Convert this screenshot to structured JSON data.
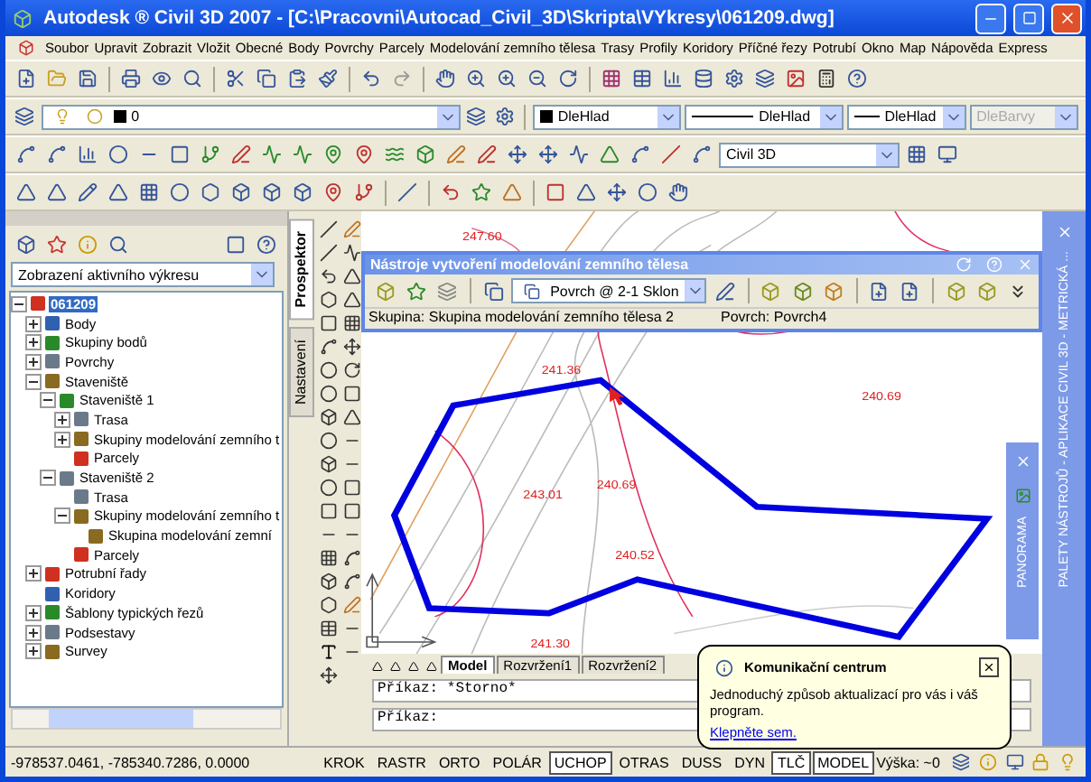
{
  "window": {
    "title": "Autodesk ® Civil 3D 2007 - [C:\\Pracovni\\Autocad_Civil_3D\\Skripta\\VYkresy\\061209.dwg]"
  },
  "menu": [
    "Soubor",
    "Upravit",
    "Zobrazit",
    "Vložit",
    "Obecné",
    "Body",
    "Povrchy",
    "Parcely",
    "Modelování zemního tělesa",
    "Trasy",
    "Profily",
    "Koridory",
    "Příčné řezy",
    "Potrubí",
    "Okno",
    "Map",
    "Nápověda",
    "Express"
  ],
  "layer_toolbar": {
    "layer": "0",
    "color_setting": "DleHlad",
    "linetype": "DleHlad",
    "lineweight": "DleHlad",
    "plot_style": {
      "value": "DleBarvy",
      "disabled": true
    }
  },
  "workspace": "Civil 3D",
  "prospector": {
    "view": "Zobrazení aktivního výkresu",
    "tree": [
      {
        "label": "061209",
        "selected": true,
        "expanded": true,
        "children": [
          {
            "label": "Body",
            "selected": false,
            "expanded": false
          },
          {
            "label": "Skupiny bodů",
            "selected": false,
            "expanded": false
          },
          {
            "label": "Povrchy",
            "selected": false,
            "expanded": false
          },
          {
            "label": "Staveniště",
            "selected": false,
            "expanded": true,
            "children": [
              {
                "label": "Staveniště 1",
                "selected": false,
                "expanded": true,
                "children": [
                  {
                    "label": "Trasa",
                    "selected": false,
                    "expanded": false
                  },
                  {
                    "label": "Skupiny modelování zemního t",
                    "selected": false,
                    "expanded": false
                  },
                  {
                    "label": "Parcely",
                    "selected": false
                  }
                ]
              },
              {
                "label": "Staveniště 2",
                "selected": false,
                "expanded": true,
                "children": [
                  {
                    "label": "Trasa",
                    "selected": false
                  },
                  {
                    "label": "Skupiny modelování zemního t",
                    "selected": false,
                    "expanded": true,
                    "children": [
                      {
                        "label": "Skupina modelování zemní",
                        "selected": false
                      }
                    ]
                  },
                  {
                    "label": "Parcely",
                    "selected": false
                  }
                ]
              }
            ]
          },
          {
            "label": "Potrubní řady",
            "selected": false,
            "expanded": false
          },
          {
            "label": "Koridory",
            "selected": false
          },
          {
            "label": "Šablony typických řezů",
            "selected": false,
            "expanded": false
          },
          {
            "label": "Podsestavy",
            "selected": false,
            "expanded": false
          },
          {
            "label": "Survey",
            "selected": false,
            "expanded": false
          }
        ]
      }
    ]
  },
  "side_tabs": [
    {
      "label": "Prospektor",
      "selected": true
    },
    {
      "label": "Nastavení",
      "selected": false
    }
  ],
  "drawing": {
    "elevation_labels": [
      "247.60",
      "241.36",
      "240.69",
      "243.01",
      "240.69",
      "240.52",
      "241.30"
    ]
  },
  "grading_toolbar": {
    "title": "Nástroje vytvoření modelování zemního tělesa",
    "criteria": "Povrch @ 2-1 Sklon",
    "group": "Skupina: Skupina modelování zemního tělesa 2",
    "surface": "Povrch: Povrch4"
  },
  "panorama": {
    "title": "PANORAMA"
  },
  "tool_palette": {
    "title": "PALETY NÁSTROJŮ - APLIKACE CIVIL 3D - METRICKÁ ..."
  },
  "layout_tabs": [
    {
      "label": "Model",
      "selected": true
    },
    {
      "label": "Rozvržení1",
      "selected": false
    },
    {
      "label": "Rozvržení2",
      "selected": false
    }
  ],
  "command_lines": [
    "Příkaz: *Storno*",
    "Příkaz:"
  ],
  "status_bar": {
    "coordinates": "-978537.0461, -785340.7286, 0.0000",
    "toggles": [
      {
        "label": "KROK",
        "on": false
      },
      {
        "label": "RASTR",
        "on": false
      },
      {
        "label": "ORTO",
        "on": false
      },
      {
        "label": "POLÁR",
        "on": false
      },
      {
        "label": "UCHOP",
        "on": true
      },
      {
        "label": "OTRAS",
        "on": false
      },
      {
        "label": "DUSS",
        "on": false
      },
      {
        "label": "DYN",
        "on": false
      },
      {
        "label": "TLČ",
        "on": true
      },
      {
        "label": "MODEL",
        "on": true
      }
    ],
    "elevation": "Výška: ~0"
  },
  "notification": {
    "title": "Komunikační centrum",
    "message": "Jednoduchý způsob aktualizací pro vás i váš program.",
    "link": "Klepněte sem."
  }
}
